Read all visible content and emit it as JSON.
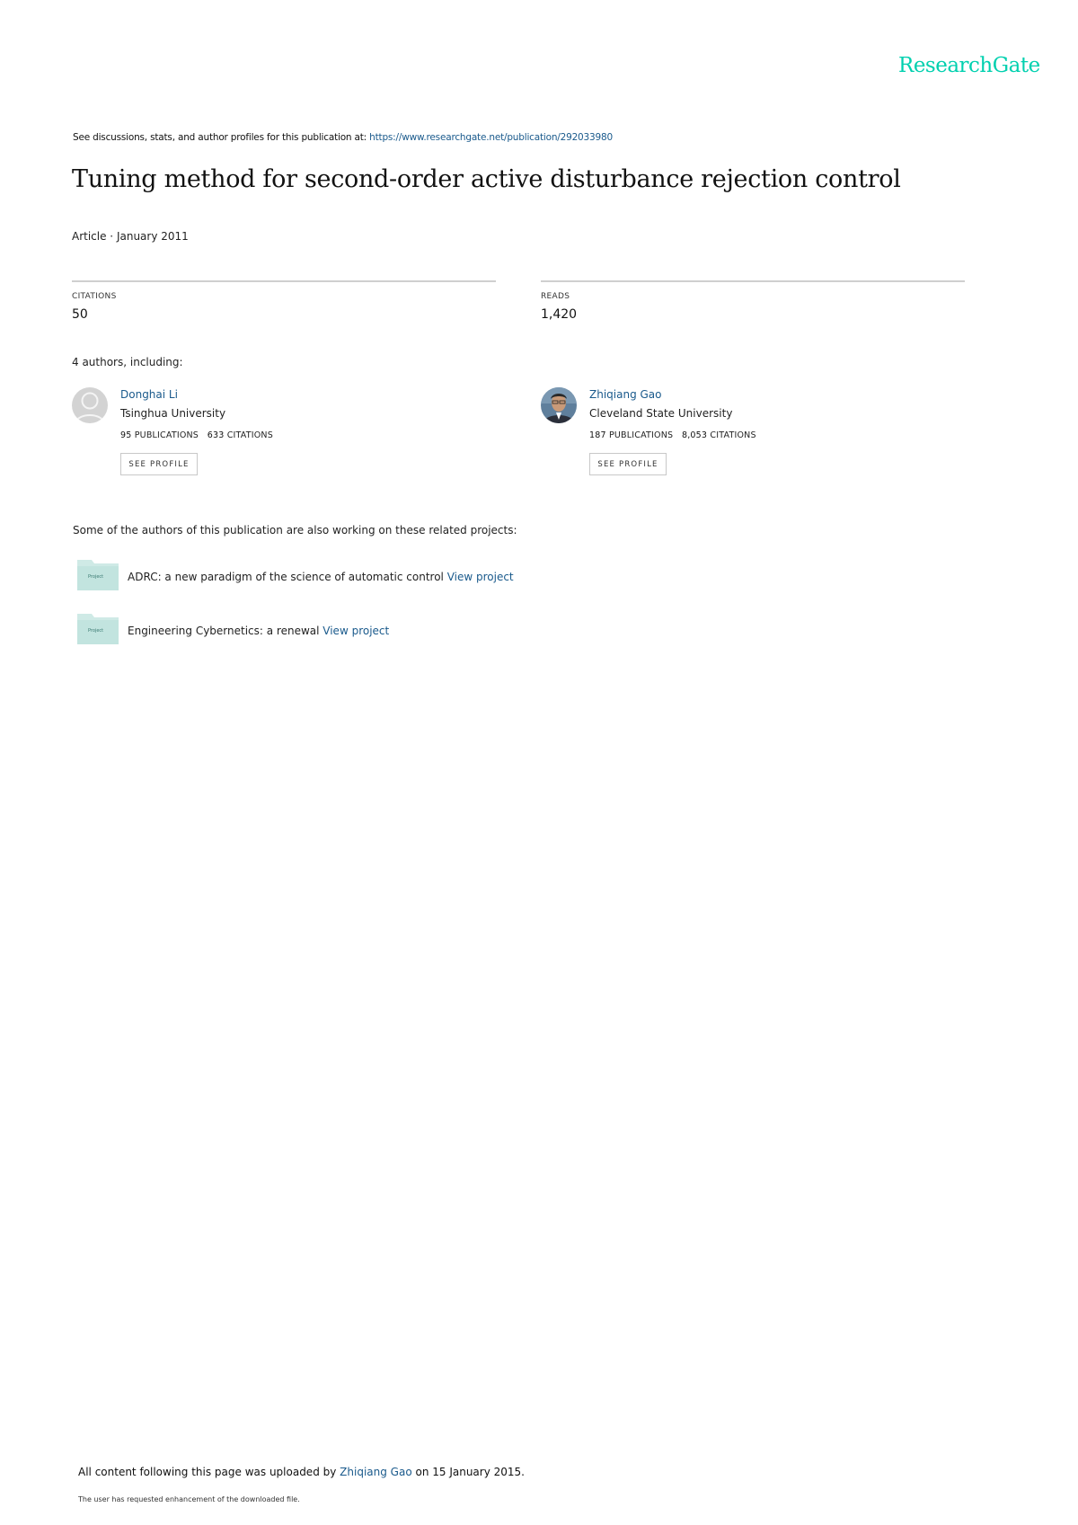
{
  "brand": {
    "logo": "ResearchGate"
  },
  "header": {
    "see_text": "See discussions, stats, and author profiles for this publication at: ",
    "url": "https://www.researchgate.net/publication/292033980"
  },
  "publication": {
    "title": "Tuning method for second-order active disturbance rejection control",
    "meta": "Article · January 2011"
  },
  "stats": {
    "citations_label": "CITATIONS",
    "citations_value": "50",
    "reads_label": "READS",
    "reads_value": "1,420"
  },
  "authors_section": {
    "intro": "4 authors, including:",
    "profile_button": "SEE PROFILE",
    "publications_label": "PUBLICATIONS",
    "citations_label": "CITATIONS",
    "authors": [
      {
        "name": "Donghai Li",
        "institution": "Tsinghua University",
        "publications": "95",
        "citations": "633"
      },
      {
        "name": "Zhiqiang Gao",
        "institution": "Cleveland State University",
        "publications": "187",
        "citations": "8,053"
      }
    ]
  },
  "projects": {
    "intro": "Some of the authors of this publication are also working on these related projects:",
    "folder_label": "Project",
    "view_label": "View project",
    "items": [
      {
        "text": "ADRC: a new paradigm of the science of automatic control "
      },
      {
        "text": "Engineering Cybernetics: a renewal "
      }
    ]
  },
  "footer": {
    "upload_prefix": "All content following this page was uploaded by ",
    "uploader": "Zhiqiang Gao",
    "upload_suffix": " on 15 January 2015.",
    "note": "The user has requested enhancement of the downloaded file."
  },
  "colors": {
    "brand": "#00d0af",
    "link": "#1a5a8c",
    "folder": "#cfeae6",
    "rule": "#cfcfcf"
  }
}
